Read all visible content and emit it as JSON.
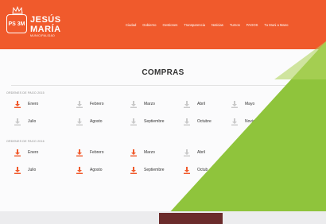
{
  "header": {
    "seal_text": "PS 3M",
    "brand_line1": "JESÚS",
    "brand_line2": "MARÍA",
    "brand_line3": "MUNICIPALIDAD",
    "nav": [
      "Ciudad",
      "Gobierno",
      "Gestiones",
      "Transparencia",
      "Noticias",
      "Turnos",
      "PAGOS",
      "Tu Muni a Mano"
    ]
  },
  "page_title": "COMPRAS",
  "sections": [
    {
      "label": "ORDENES DE PAGO 2015",
      "rows": [
        [
          "Enero",
          "Febrero",
          "Marzo",
          "Abril",
          "Mayo"
        ],
        [
          "Julio",
          "Agosto",
          "Septiembre",
          "Octubre",
          "Noviem"
        ]
      ],
      "icon_state": [
        [
          "active",
          "inactive",
          "inactive",
          "inactive",
          "inactive"
        ],
        [
          "inactive",
          "inactive",
          "inactive",
          "inactive",
          "inactive"
        ]
      ]
    },
    {
      "label": "ORDENES DE PAGO 2016",
      "rows": [
        [
          "Enero",
          "Febrero",
          "Marzo",
          "Abril",
          ""
        ],
        [
          "Julio",
          "Agosto",
          "Septiembre",
          "Octub",
          ""
        ]
      ],
      "icon_state": [
        [
          "active",
          "active",
          "active",
          "inactive",
          ""
        ],
        [
          "active",
          "active",
          "active",
          "active",
          ""
        ]
      ]
    }
  ],
  "colors": {
    "brand": "#f05a2c",
    "accent_overlay": "#8fc43c",
    "accent_overlay_light": "#b3d65f"
  },
  "icons": {
    "download": "download-icon"
  }
}
